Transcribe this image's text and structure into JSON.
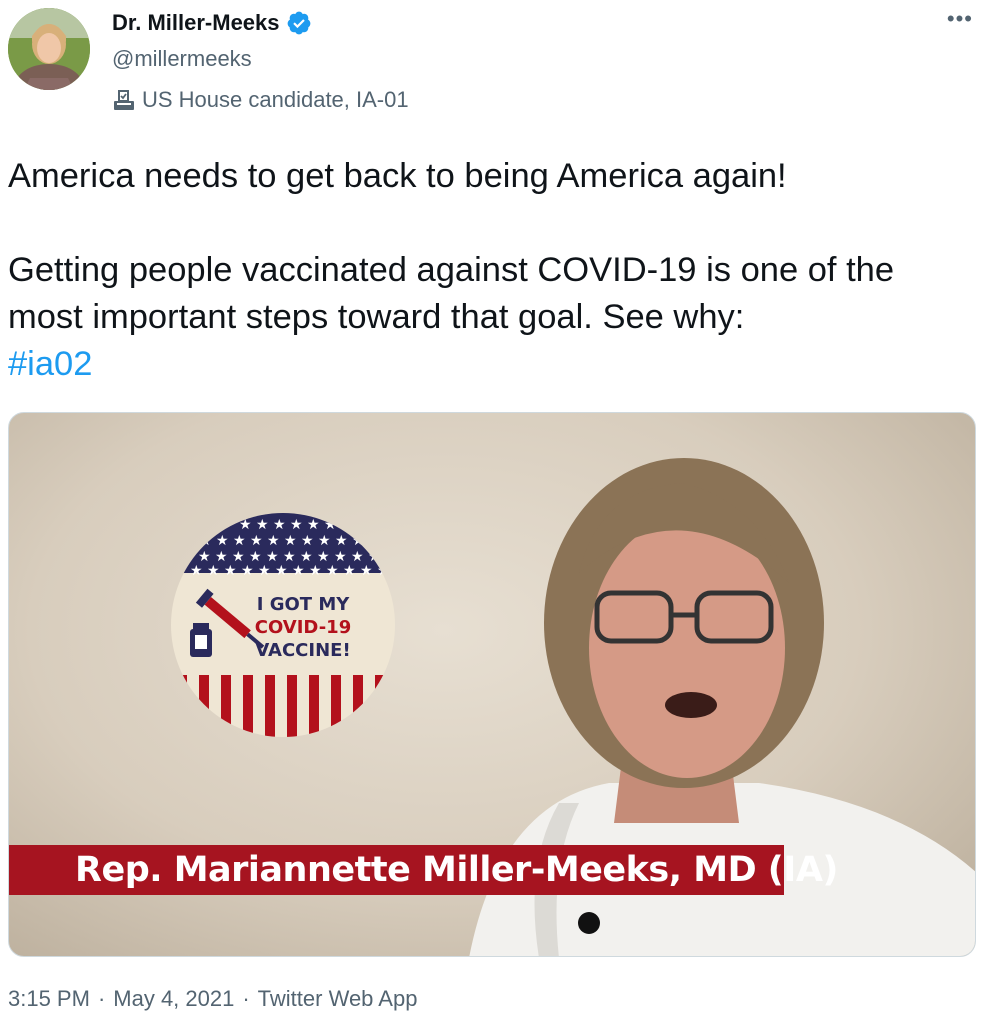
{
  "author": {
    "name": "Dr. Miller-Meeks",
    "handle": "@millermeeks",
    "label": "US House candidate, IA-01",
    "verified": true
  },
  "menu": {
    "more_label": "•••"
  },
  "tweet": {
    "line1": "America needs to get back to being America again!",
    "line2": "Getting people vaccinated against COVID-19 is one of the most important steps toward that goal. See why:",
    "hashtag": "#ia02"
  },
  "media": {
    "badge_line1": "I GOT MY",
    "badge_line2": "COVID-19",
    "badge_line3": "VACCINE!",
    "caption": "Rep. Mariannette Miller-Meeks, MD (IA)"
  },
  "meta": {
    "time": "3:15 PM",
    "separator": "·",
    "date": "May 4, 2021",
    "source": "Twitter Web App"
  },
  "colors": {
    "link": "#1d9bf0",
    "secondary_text": "#536471",
    "caption_bar": "#a61420",
    "badge_navy": "#2a2a5c",
    "badge_red": "#b3111c"
  }
}
